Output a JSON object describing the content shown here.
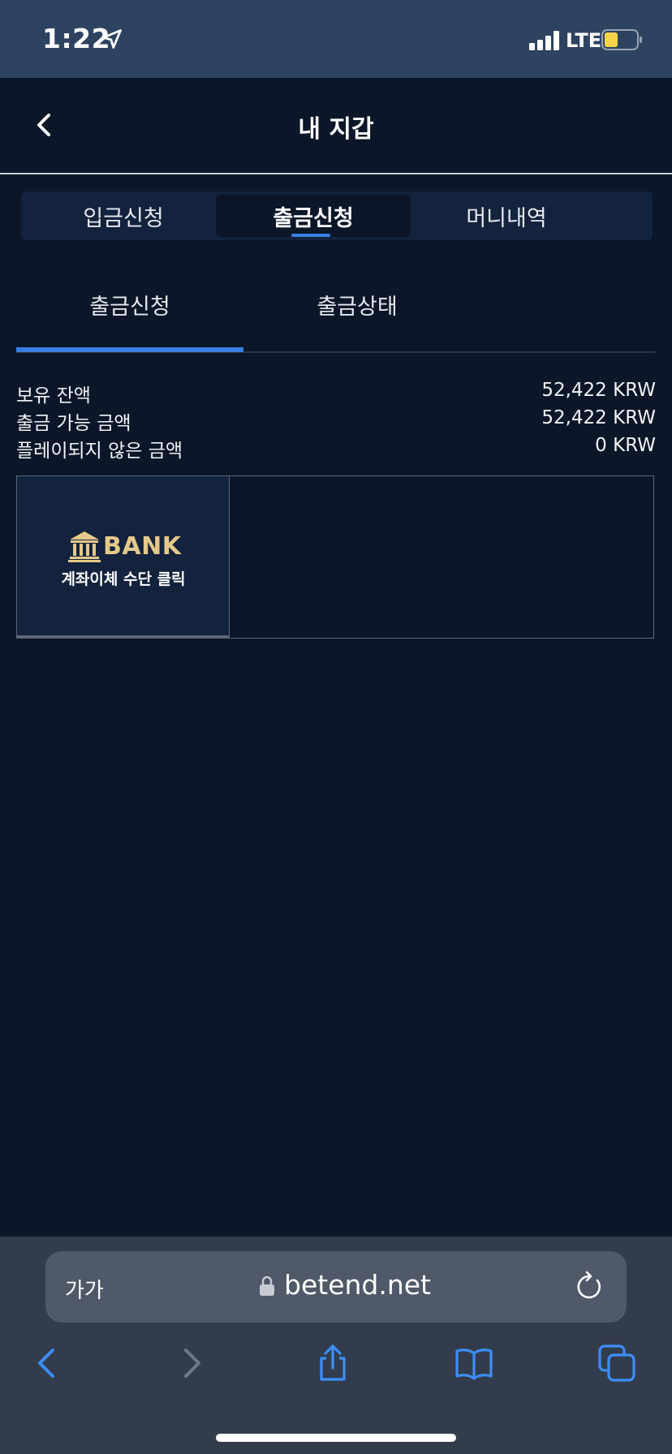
{
  "status_bar": {
    "time": "1:22",
    "network": "LTE",
    "icons": [
      "location-arrow-icon",
      "signal-icon",
      "battery-icon"
    ],
    "battery_color": "#f5d34a"
  },
  "header": {
    "title": "내 지갑",
    "back_icon": "chevron-left-icon"
  },
  "tabs": [
    {
      "label": "입금신청",
      "active": false
    },
    {
      "label": "출금신청",
      "active": true
    },
    {
      "label": "머니내역",
      "active": false
    }
  ],
  "subtabs": [
    {
      "label": "출금신청",
      "active": true
    },
    {
      "label": "출금상태",
      "active": false
    }
  ],
  "balances": [
    {
      "label": "보유 잔액",
      "value": "52,422 KRW"
    },
    {
      "label": "출금 가능 금액",
      "value": "52,422 KRW"
    },
    {
      "label": "플레이되지 않은 금액",
      "value": "0 KRW"
    }
  ],
  "bank_card": {
    "logo_text": "BANK",
    "subtitle": "계좌이체 수단 클릭",
    "icon": "bank-building-icon",
    "accent": "#e6c98a"
  },
  "browser": {
    "text_size_label": "가가",
    "url": "betend.net",
    "icons": [
      "lock-icon",
      "reload-icon",
      "back-arrow-icon",
      "forward-arrow-icon",
      "share-icon",
      "bookmarks-icon",
      "tabs-icon"
    ]
  },
  "colors": {
    "background": "#0b1628",
    "accent": "#3a7fe0",
    "status_bar": "#2e4360"
  }
}
